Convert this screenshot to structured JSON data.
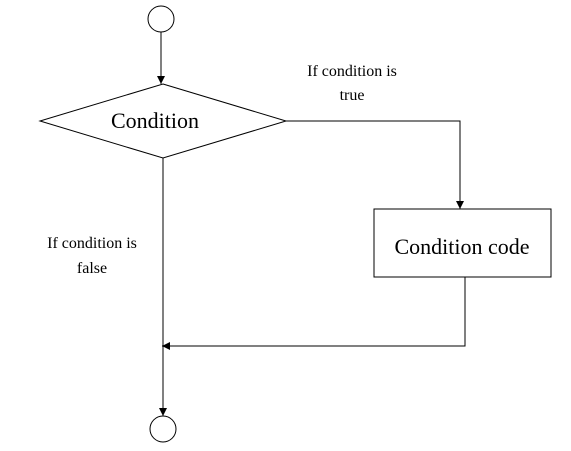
{
  "diagram": {
    "decision_label": "Condition",
    "process_label": "Condition code",
    "true_label": {
      "line1": "If condition is",
      "line2": "true"
    },
    "false_label": {
      "line1": "If condition is",
      "line2": "false"
    }
  },
  "colors": {
    "stroke": "#000000",
    "fill": "#ffffff"
  }
}
